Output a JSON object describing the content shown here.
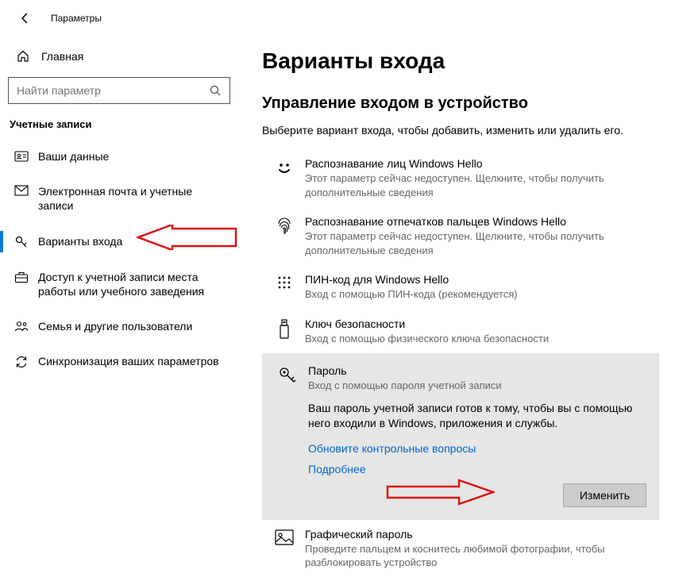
{
  "titlebar": {
    "title": "Параметры"
  },
  "sidebar": {
    "home": "Главная",
    "search_placeholder": "Найти параметр",
    "section": "Учетные записи",
    "items": [
      {
        "label": "Ваши данные"
      },
      {
        "label": "Электронная почта и учетные записи"
      },
      {
        "label": "Варианты входа"
      },
      {
        "label": "Доступ к учетной записи места работы или учебного заведения"
      },
      {
        "label": "Семья и другие пользователи"
      },
      {
        "label": "Синхронизация ваших параметров"
      }
    ]
  },
  "main": {
    "heading": "Варианты входа",
    "subheading": "Управление входом в устройство",
    "lead": "Выберите вариант входа, чтобы добавить, изменить или удалить его.",
    "options": [
      {
        "title": "Распознавание лиц Windows Hello",
        "sub": "Этот параметр сейчас недоступен. Щелкните, чтобы получить дополнительные сведения"
      },
      {
        "title": "Распознавание отпечатков пальцев Windows Hello",
        "sub": "Этот параметр сейчас недоступен. Щелкните, чтобы получить дополнительные сведения"
      },
      {
        "title": "ПИН-код для Windows Hello",
        "sub": "Вход с помощью ПИН-кода (рекомендуется)"
      },
      {
        "title": "Ключ безопасности",
        "sub": "Вход с помощью физического ключа безопасности"
      },
      {
        "title": "Пароль",
        "sub": "Вход с помощью пароля учетной записи",
        "desc": "Ваш пароль учетной записи готов к тому, чтобы вы с помощью него входили в Windows, приложения и службы.",
        "link1": "Обновите контрольные вопросы",
        "link2": "Подробнее",
        "button": "Изменить"
      },
      {
        "title": "Графический пароль",
        "sub": "Проведите пальцем и коснитесь любимой фотографии, чтобы разблокировать устройство"
      }
    ]
  }
}
